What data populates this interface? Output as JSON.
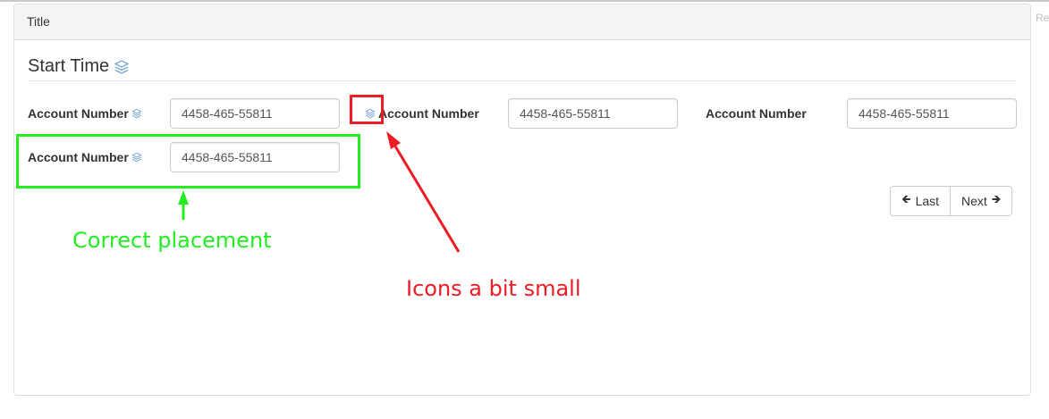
{
  "panel": {
    "title": "Title"
  },
  "edge_text": "Re",
  "section": {
    "title": "Start Time",
    "icon": "layers-icon"
  },
  "fields": [
    {
      "label": "Account Number",
      "value": "4458-465-55811",
      "icon": "layers-icon",
      "icon_position": "after-label"
    },
    {
      "label": "Account Number",
      "value": "4458-465-55811",
      "icon": "layers-icon",
      "icon_position": "before-label"
    },
    {
      "label": "Account Number",
      "value": "4458-465-55811",
      "icon": "none"
    },
    {
      "label": "Account Number",
      "value": "4458-465-55811",
      "icon": "layers-icon",
      "icon_position": "after-label"
    }
  ],
  "pager": {
    "prev_label": "Last",
    "next_label": "Next",
    "prev_icon": "arrow-left-icon",
    "next_icon": "arrow-right-icon"
  },
  "annotations": {
    "correct": {
      "text": "Correct placement",
      "color": "#22ee22"
    },
    "small": {
      "text": "Icons a bit small",
      "color": "#ee1c25"
    }
  },
  "colors": {
    "icon": "#7aa8d6",
    "heading_bg": "#f5f5f5",
    "border": "#dddddd"
  }
}
